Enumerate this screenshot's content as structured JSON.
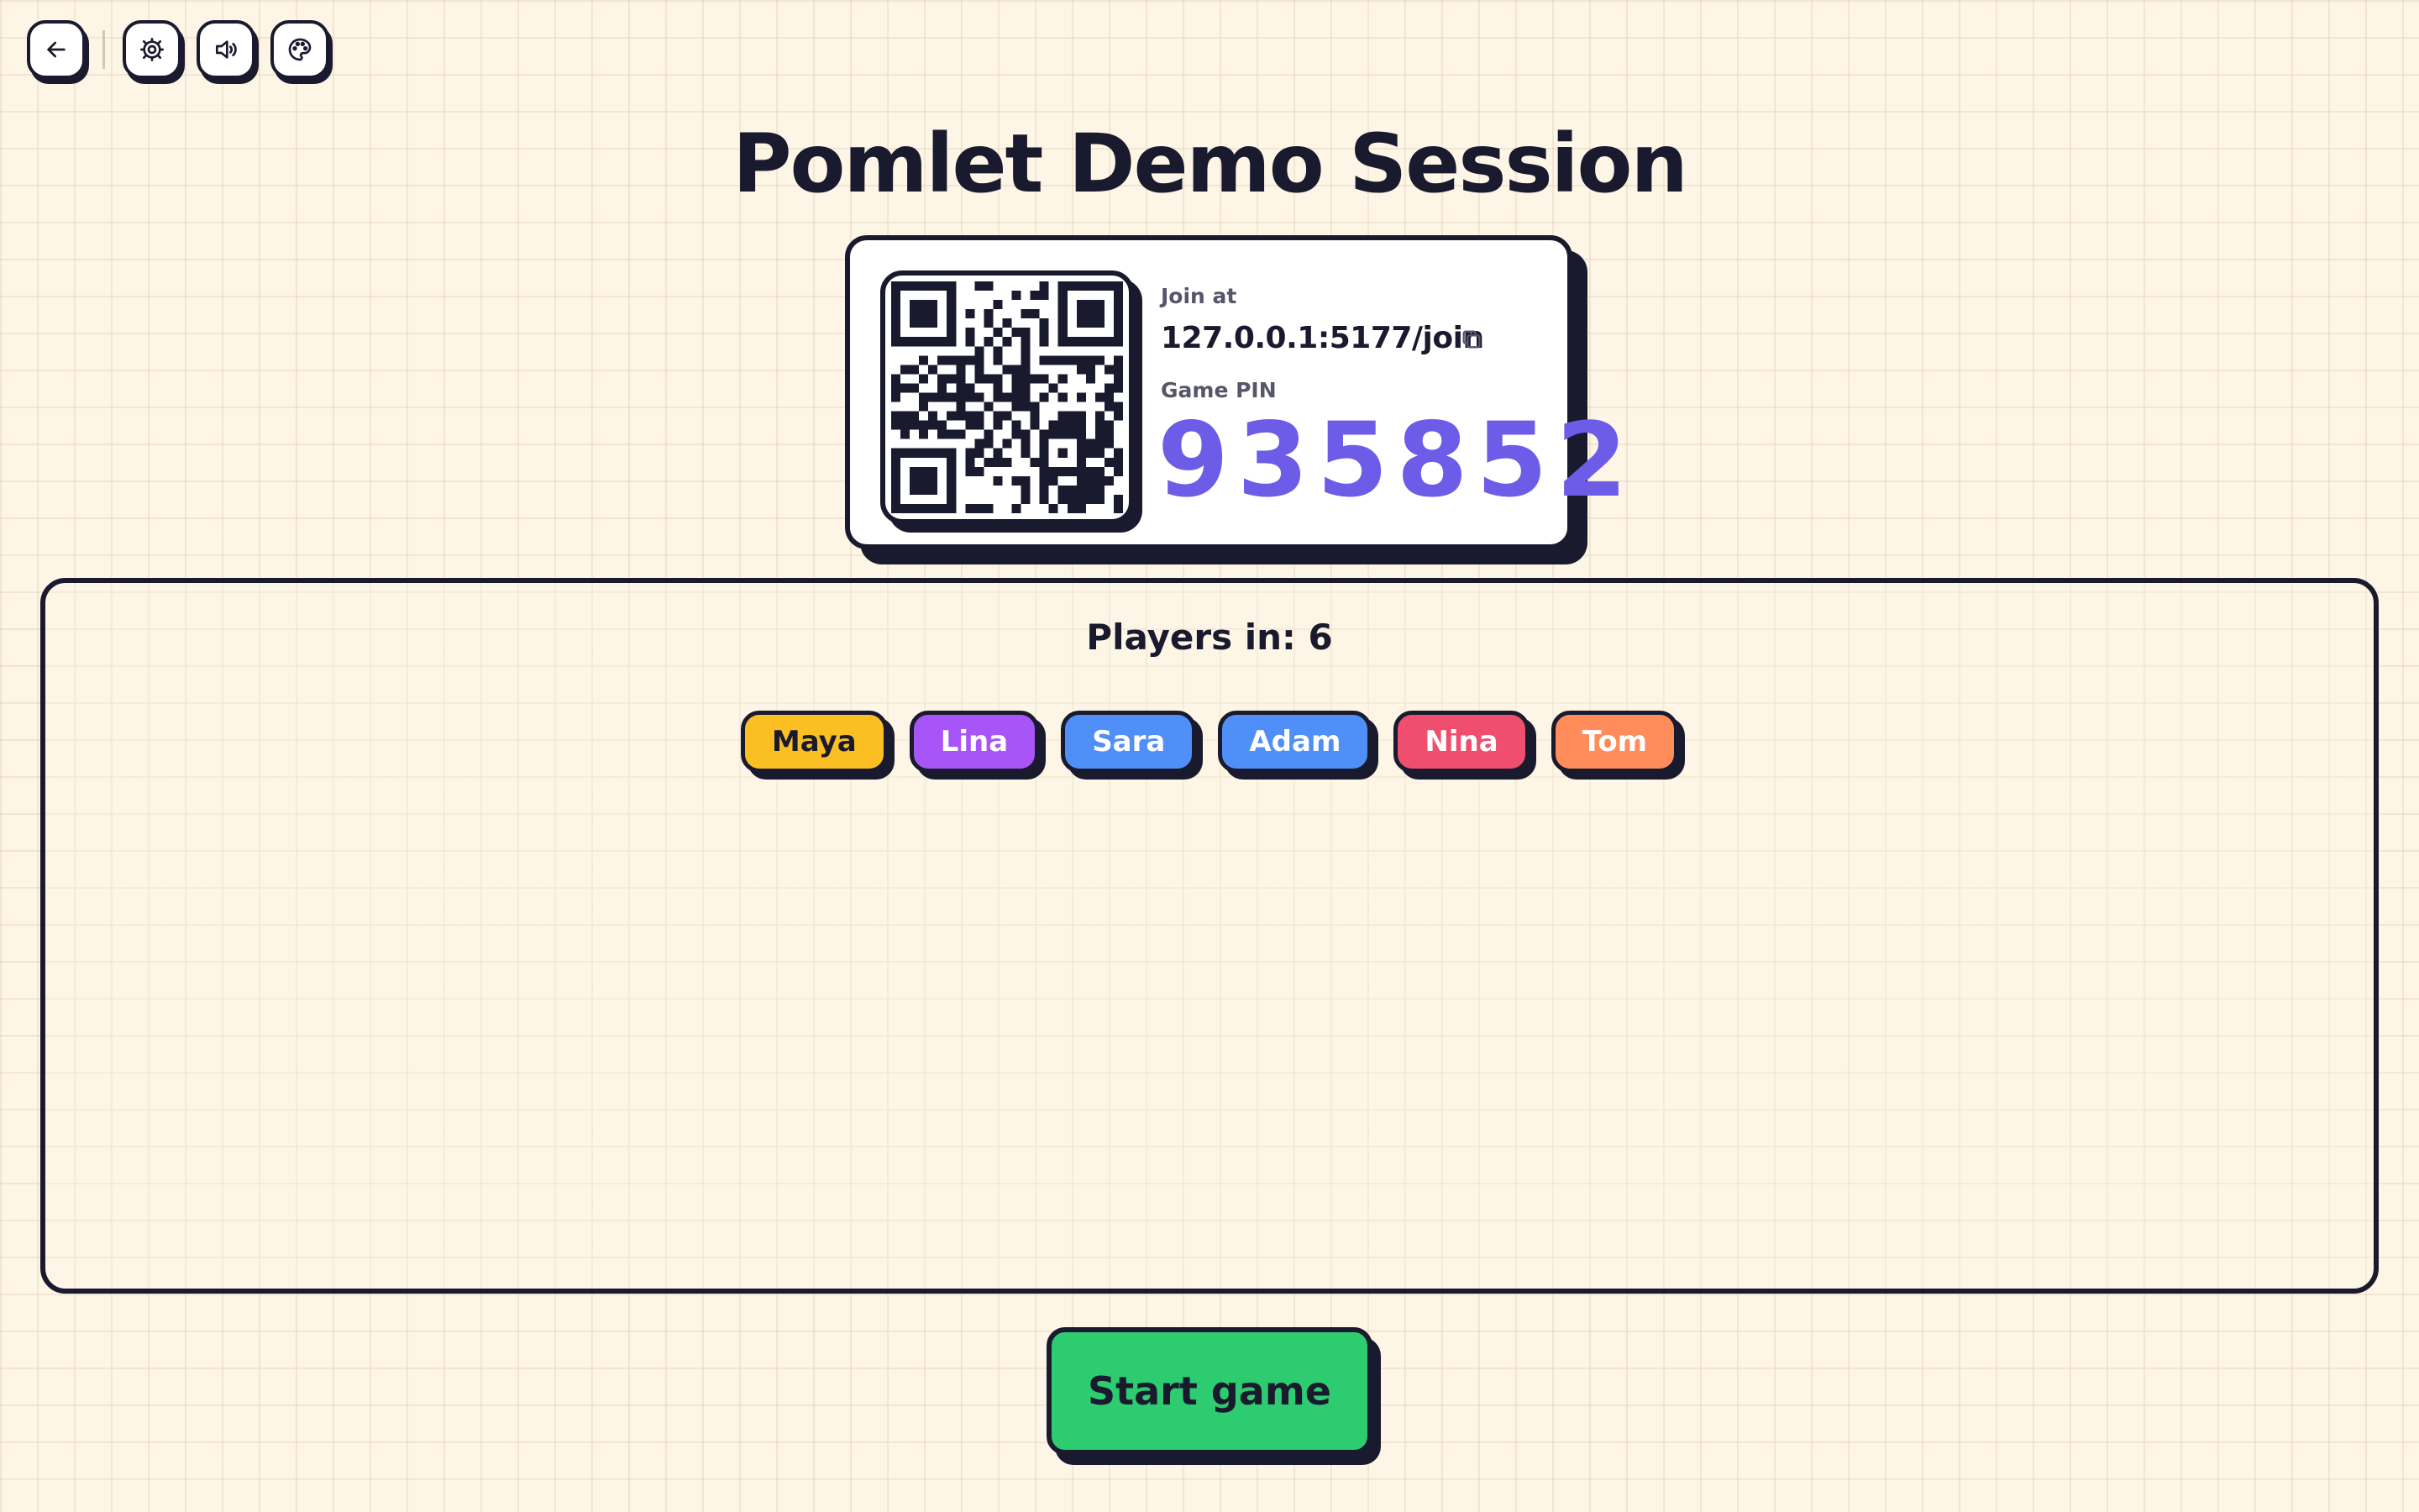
{
  "toolbar": {
    "buttons": [
      {
        "name": "back",
        "icon": "arrow-left-icon"
      },
      {
        "name": "settings",
        "icon": "gear-icon"
      },
      {
        "name": "sound",
        "icon": "speaker-icon"
      },
      {
        "name": "theme",
        "icon": "palette-icon"
      }
    ]
  },
  "title": "Pomlet Demo Session",
  "join": {
    "label": "Join at",
    "url": "127.0.0.1:5177/join",
    "copy_icon": "copy-icon",
    "qr_icon": "qr-code-icon"
  },
  "pin": {
    "label": "Game PIN",
    "value": "935852",
    "color": "#6c5ce7"
  },
  "players": {
    "label": "Players in:",
    "count": "6",
    "list": [
      {
        "name": "Maya",
        "color": "#fbbf24",
        "text_color": "#1a1a2e"
      },
      {
        "name": "Lina",
        "color": "#a855f7",
        "text_color": "#ffffff"
      },
      {
        "name": "Sara",
        "color": "#4f8ff7",
        "text_color": "#ffffff"
      },
      {
        "name": "Adam",
        "color": "#4f8ff7",
        "text_color": "#ffffff"
      },
      {
        "name": "Nina",
        "color": "#f04e6e",
        "text_color": "#ffffff"
      },
      {
        "name": "Tom",
        "color": "#ff8c5a",
        "text_color": "#ffffff"
      }
    ]
  },
  "start_button": {
    "label": "Start game",
    "color": "#2ecc71"
  },
  "colors": {
    "background": "#fdf5e6",
    "ink": "#1a1a2e"
  }
}
